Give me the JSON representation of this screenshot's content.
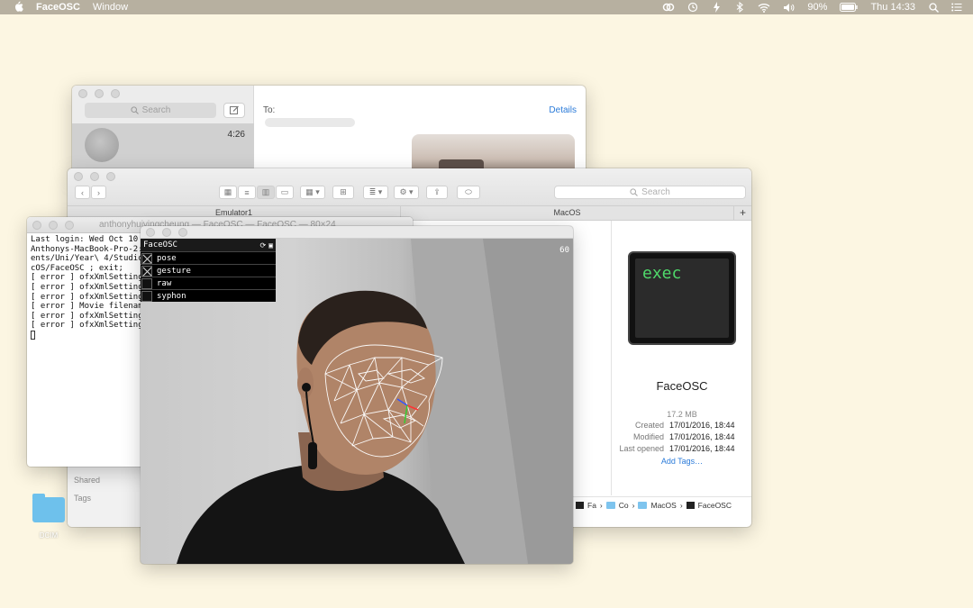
{
  "menubar": {
    "app_name": "FaceOSC",
    "menus": [
      "Window"
    ],
    "battery": "90%",
    "clock": "Thu 14:33"
  },
  "messages": {
    "search_placeholder": "Search",
    "conversation_time": "4:26",
    "to_label": "To:",
    "details_label": "Details"
  },
  "finder": {
    "search_placeholder": "Search",
    "tabs": [
      "Emulator1",
      "MacOS"
    ],
    "sidebar": {
      "shared": "Shared",
      "tags": "Tags"
    },
    "preview": {
      "icon_text": "exec",
      "name": "FaceOSC",
      "size": "17.2 MB",
      "created_label": "Created",
      "created_value": "17/01/2016, 18:44",
      "modified_label": "Modified",
      "modified_value": "17/01/2016, 18:44",
      "opened_label": "Last opened",
      "opened_value": "17/01/2016, 18:44",
      "add_tags": "Add Tags…"
    },
    "path": [
      "Fa",
      "Co",
      "MacOS",
      "FaceOSC"
    ]
  },
  "terminal": {
    "title": "anthonyhuiyingcheung — FaceOSC — FaceOSC — 80×24",
    "lines": [
      "Last login: Wed Oct 10",
      "Anthonys-MacBook-Pro-2:",
      "ents/Uni/Year\\ 4/Studio",
      "cOS/FaceOSC ; exit;",
      "[ error ] ofxXmlSetting",
      "[ error ] ofxXmlSetting",
      "[ error ] ofxXmlSetting",
      "[ error ] Movie filenam",
      "[ error ] ofxXmlSetting",
      "[ error ] ofxXmlSetting"
    ]
  },
  "faceosc": {
    "fps": "60",
    "panel_title": "FaceOSC",
    "toggles": [
      {
        "label": "pose",
        "checked": true
      },
      {
        "label": "gesture",
        "checked": true
      },
      {
        "label": "raw",
        "checked": false
      },
      {
        "label": "syphon",
        "checked": false
      }
    ]
  },
  "desktop": {
    "folder_label": "DCIM"
  },
  "colors": {
    "desktop": "#fcf6e2",
    "accent": "#2b7bd9",
    "exec_green": "#4fd86a",
    "folder": "#6ec1ec"
  }
}
